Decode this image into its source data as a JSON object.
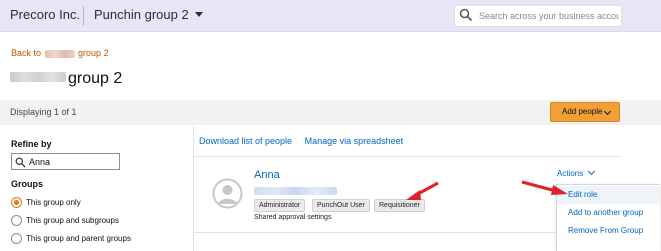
{
  "topbar": {
    "company": "Precoro Inc.",
    "group_selector": "Punchin group 2",
    "search_placeholder": "Search across your business account"
  },
  "breadcrumb": {
    "back_prefix": "Back to",
    "back_suffix": "group 2"
  },
  "page": {
    "title_suffix": "group 2"
  },
  "results": {
    "display_count": "Displaying 1 of 1",
    "add_people_label": "Add people"
  },
  "refine": {
    "title": "Refine by",
    "filter_value": "Anna",
    "groups_title": "Groups",
    "options": [
      {
        "label": "This group only",
        "checked": true
      },
      {
        "label": "This group and subgroups",
        "checked": false
      },
      {
        "label": "This group and parent groups",
        "checked": false
      }
    ]
  },
  "toplinks": {
    "download": "Download list of people",
    "spreadsheet": "Manage via spreadsheet"
  },
  "user": {
    "name": "Anna",
    "roles": [
      "Administrator",
      "PunchOut User",
      "Requisitioner"
    ],
    "approval": "Shared approval settings"
  },
  "actions": {
    "label": "Actions",
    "menu": [
      "Edit role",
      "Add to another group",
      "Remove From Group"
    ]
  },
  "colors": {
    "accent_orange": "#f0a036",
    "link_blue": "#0066c0",
    "annotation_red": "#e0202a",
    "header_bg": "#e9e5f6"
  },
  "icons": [
    "search-icon",
    "chevron-down-icon",
    "user-avatar-icon",
    "arrow-annotation"
  ]
}
